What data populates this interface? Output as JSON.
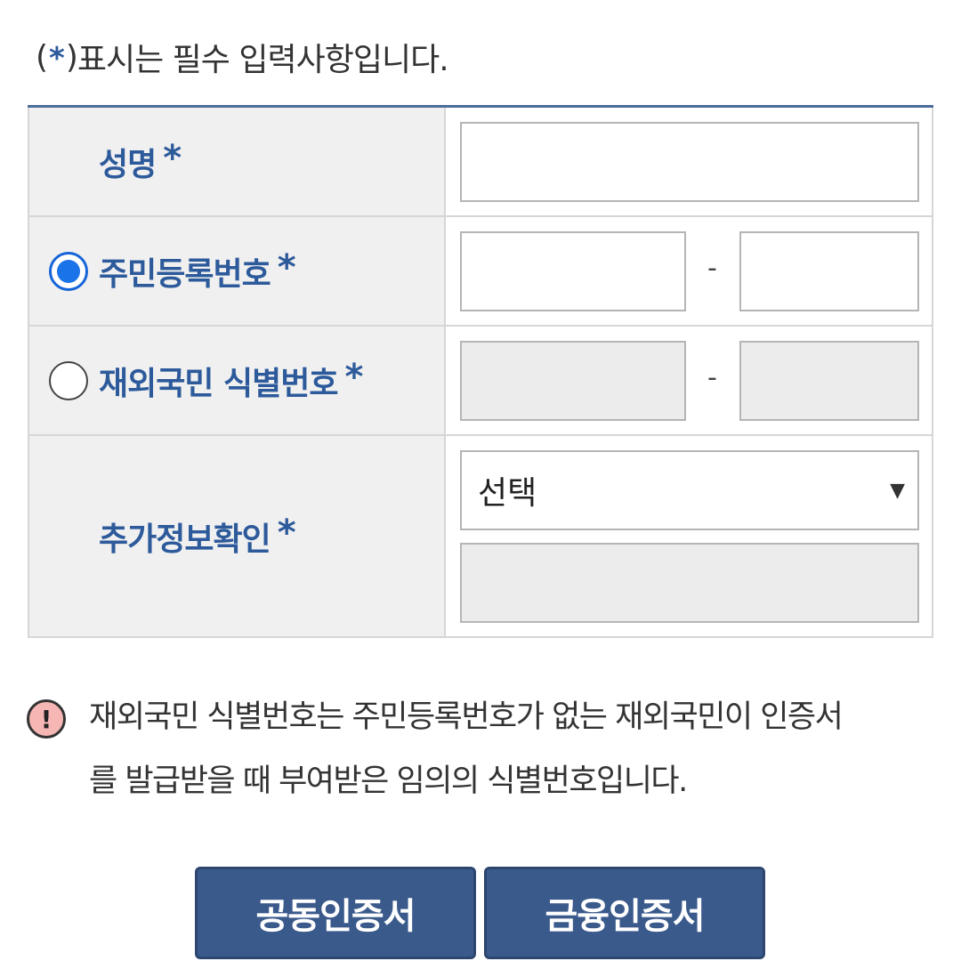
{
  "required_note": {
    "open": "(",
    "star": "*",
    "close": ")",
    "text": " 표시는 필수 입력사항입니다."
  },
  "form": {
    "name": {
      "label": "성명",
      "star": "*",
      "value": ""
    },
    "rrn": {
      "label": "주민등록번호",
      "star": "*",
      "selected": true,
      "front": "",
      "back": "",
      "separator": "-"
    },
    "foreign_id": {
      "label": "재외국민 식별번호",
      "star": "*",
      "selected": false,
      "front": "",
      "back": "",
      "separator": "-"
    },
    "extra": {
      "label": "추가정보확인",
      "star": "*",
      "select_value": "선택",
      "select_arrow": "▼",
      "input_value": ""
    }
  },
  "info": {
    "icon": "!",
    "line1": "재외국민 식별번호는 주민등록번호가 없는 재외국민이 인증서",
    "line2": "를 발급받을 때 부여받은 임의의 식별번호입니다."
  },
  "buttons": {
    "joint_cert": "공동인증서",
    "finance_cert": "금융인증서"
  },
  "colors": {
    "accent": "#2d5a9b",
    "button_bg": "#3b5a8c",
    "radio_selected": "#1a73e8"
  }
}
